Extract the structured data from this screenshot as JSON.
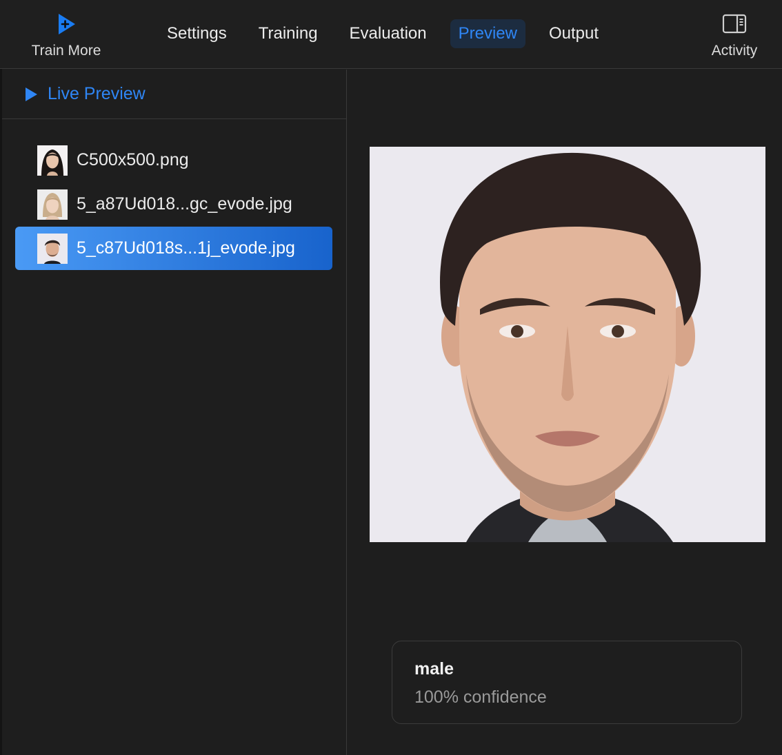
{
  "toolbar": {
    "train_more_label": "Train More",
    "activity_label": "Activity",
    "tabs": [
      {
        "label": "Settings",
        "active": false
      },
      {
        "label": "Training",
        "active": false
      },
      {
        "label": "Evaluation",
        "active": false
      },
      {
        "label": "Preview",
        "active": true
      },
      {
        "label": "Output",
        "active": false
      }
    ]
  },
  "sidebar": {
    "header_title": "Live Preview",
    "files": [
      {
        "name": "C500x500.png",
        "selected": false
      },
      {
        "name": "5_a87Ud018...gc_evode.jpg",
        "selected": false
      },
      {
        "name": "5_c87Ud018s...1j_evode.jpg",
        "selected": true
      }
    ]
  },
  "result": {
    "label": "male",
    "confidence": "100% confidence"
  },
  "colors": {
    "accent": "#2f86f5",
    "background": "#1e1e1e",
    "selection_start": "#4a9af5",
    "selection_end": "#1863cc"
  },
  "icons": {
    "train_more": "play-plus-icon",
    "activity": "sidebar-toggle-icon",
    "live_preview": "play-icon"
  }
}
